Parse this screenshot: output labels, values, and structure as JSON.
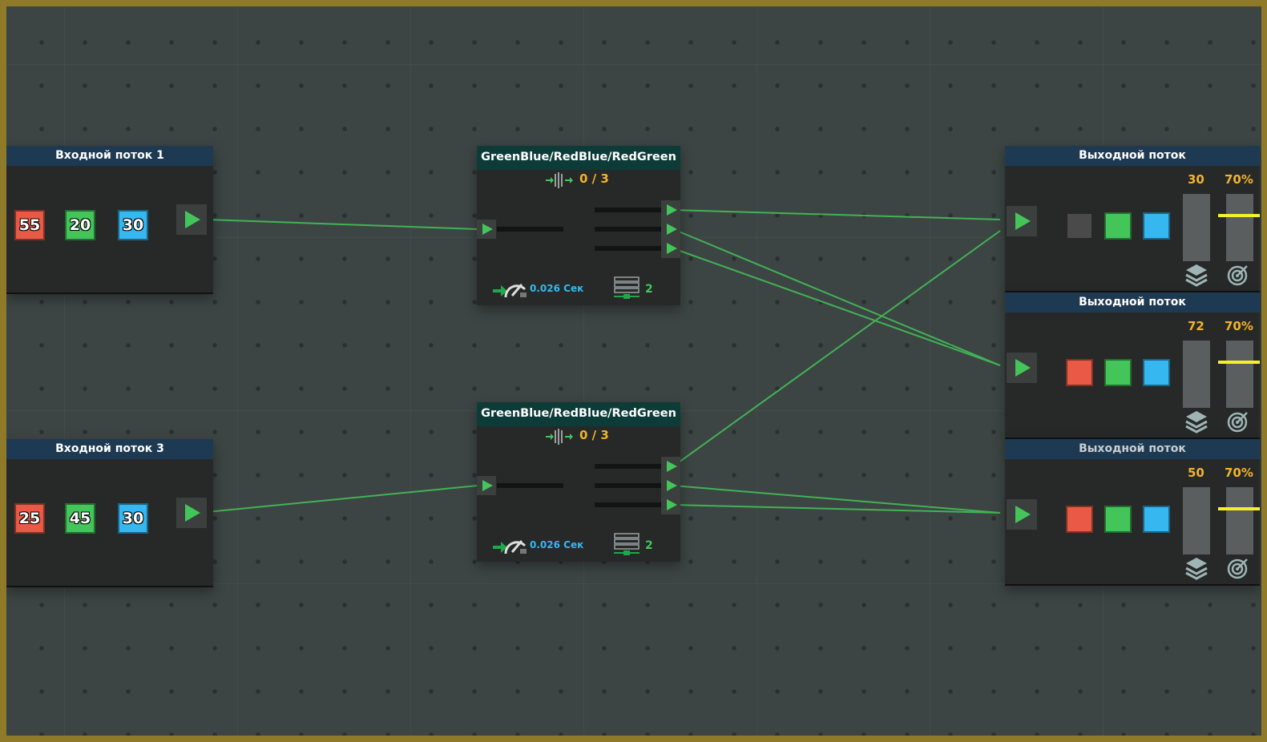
{
  "colors": {
    "frame": "#8f7a2a",
    "board": "#3c4543",
    "wire": "#44c55a",
    "red": "#e85a46",
    "green": "#44c55a",
    "blue": "#36b7f0",
    "gray": "#4a4a4a",
    "orange": "#f3b32a",
    "yellow": "#f5f02a"
  },
  "inputs": [
    {
      "title": "Входной поток 1",
      "values": [
        "55",
        "20",
        "30"
      ]
    },
    {
      "title": "Входной поток 3",
      "values": [
        "25",
        "45",
        "30"
      ]
    }
  ],
  "splitters": [
    {
      "title": "GreenBlue/RedBlue/RedGreen",
      "counter": "0 / 3",
      "speed": "0.026 Сек",
      "buffer": "2"
    },
    {
      "title": "GreenBlue/RedBlue/RedGreen",
      "counter": "0 / 3",
      "speed": "0.026 Сек",
      "buffer": "2"
    }
  ],
  "outputs": [
    {
      "title": "Выходной поток",
      "count": "30",
      "percent": "70%",
      "percent_value": 0.7,
      "squares": [
        "gray",
        "green",
        "blue"
      ]
    },
    {
      "title": "Выходной поток",
      "count": "72",
      "percent": "70%",
      "percent_value": 0.7,
      "squares": [
        "red",
        "green",
        "blue"
      ]
    },
    {
      "title": "Выходной поток",
      "count": "50",
      "percent": "70%",
      "percent_value": 0.7,
      "squares": [
        "red",
        "green",
        "blue"
      ]
    }
  ],
  "icons": {
    "play": "play-arrow-icon",
    "gauge": "speed-gauge-icon",
    "buffer": "buffer-stack-icon",
    "layers": "layers-icon",
    "target": "target-icon",
    "counter": "throughput-counter-icon"
  }
}
